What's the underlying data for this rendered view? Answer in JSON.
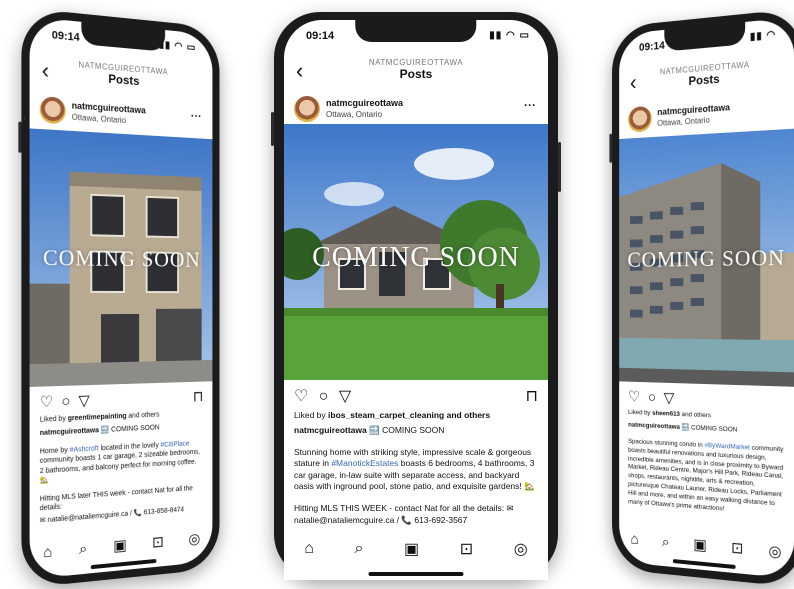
{
  "phones": [
    {
      "time": "09:14",
      "handle": "NATMCGUIREOTTAWA",
      "title": "Posts",
      "username": "natmcguireottawa",
      "location": "Ottawa, Ontario",
      "overlay": "COMING SOON",
      "liked_prefix": "Liked by ",
      "liked_user": "greentimepainting",
      "liked_suffix": " and others",
      "cap_user": "natmcguireottawa",
      "cap_headline": "🔜 COMING SOON",
      "body_pre": "Home by ",
      "body_tag1": "#Ashcroft",
      "body_mid": " located in the lovely ",
      "body_tag2": "#CitiPlace",
      "body_post": " community boasts 1 car garage, 2 sizeable bedrooms, 2 bathrooms, and balcony perfect for morning coffee. 🏡",
      "hitting": "Hitting MLS later THIS week - contact Nat for all the details:",
      "contact": "✉ natalie@nataliemcguire.ca / 📞 613-858-8474"
    },
    {
      "time": "09:14",
      "handle": "NATMCGUIREOTTAWA",
      "title": "Posts",
      "username": "natmcguireottawa",
      "location": "Ottawa, Ontario",
      "overlay": "COMING SOON",
      "liked_prefix": "Liked by ",
      "liked_user": "ibos_steam_carpet_cleaning",
      "liked_suffix": " and others",
      "cap_user": "natmcguireottawa",
      "cap_headline": "🔜 COMING SOON",
      "body_pre": "Stunning home with striking style, impressive scale & gorgeous stature in ",
      "body_tag1": "#ManotickEstates",
      "body_mid": "",
      "body_tag2": "",
      "body_post": " boasts 6 bedrooms, 4 bathrooms, 3 car garage, in-law suite with separate access, and backyard oasis with inground pool, stone patio, and exquisite gardens! 🏡",
      "hitting": "Hitting MLS THIS WEEK - contact Nat for all the details: ✉",
      "contact": "natalie@nataliemcguire.ca / 📞 613-692-3567"
    },
    {
      "time": "09:14",
      "handle": "NATMCGUIREOTTAWA",
      "title": "Posts",
      "username": "natmcguireottawa",
      "location": "Ottawa, Ontario",
      "overlay": "COMING SOON",
      "liked_prefix": "Liked by ",
      "liked_user": "sheen613",
      "liked_suffix": " and others",
      "cap_user": "natmcguireottawa",
      "cap_headline": "🔜 COMING SOON",
      "body_pre": "Spacious stunning condo in ",
      "body_tag1": "#ByWardMarket",
      "body_mid": "",
      "body_tag2": "",
      "body_post": " community boasts beautiful renovations and luxurious design, incredible amenities, and is in close proximity to Byward Market, Rideau Centre, Major's Hill Park, Rideau Canal, shops, restaurants, nightlife, arts & recreation, picturesque Chateau Laurier, Rideau Locks, Parliament Hill and more, and within an easy walking distance to many of Ottawa's prime attractions!",
      "hitting": "",
      "contact": ""
    }
  ],
  "icons": {
    "back": "‹",
    "more": "···",
    "like": "♡",
    "comment": "○",
    "share": "▽",
    "save": "⊓",
    "home": "⌂",
    "search": "⌕",
    "reels": "▣",
    "shop": "⊡",
    "profile": "◎"
  }
}
